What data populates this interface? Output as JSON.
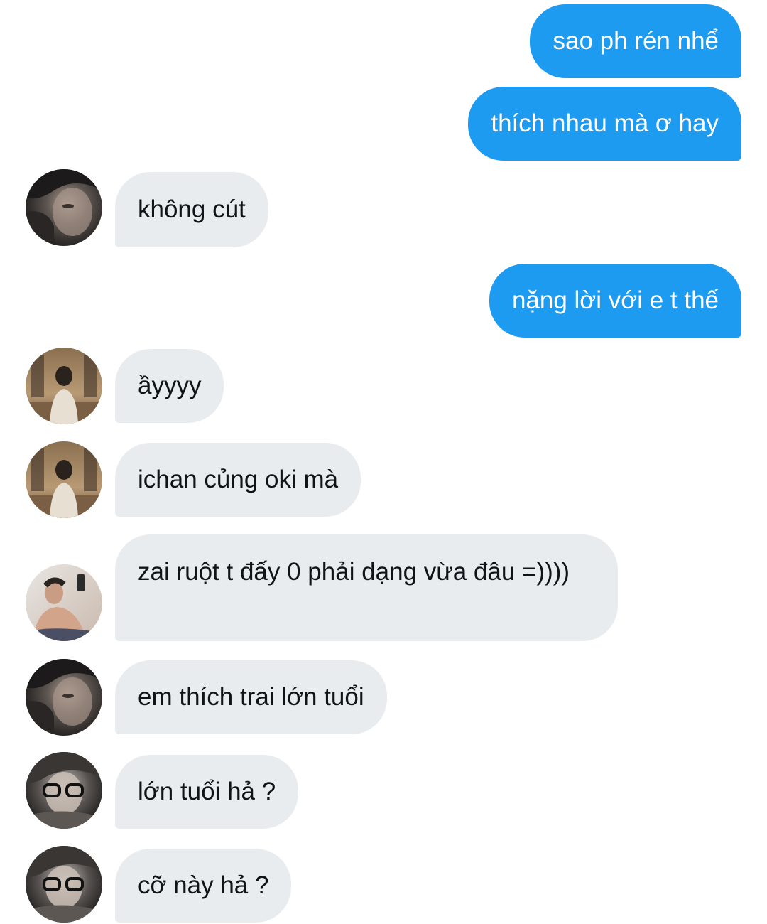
{
  "conversation": {
    "messages": [
      {
        "direction": "outgoing",
        "text": "sao ph rén nhể"
      },
      {
        "direction": "outgoing",
        "text": "thích nhau mà ơ hay"
      },
      {
        "direction": "incoming",
        "avatar": "girl-avatar",
        "text": "không cút"
      },
      {
        "direction": "outgoing",
        "text": "nặng lời với e t thế"
      },
      {
        "direction": "incoming",
        "avatar": "hallway-guy-avatar",
        "text": "ầyyyy"
      },
      {
        "direction": "incoming",
        "avatar": "hallway-guy-avatar",
        "text": "ichan củng oki mà"
      },
      {
        "direction": "incoming",
        "avatar": "mirror-selfie-avatar",
        "text": "zai ruột t đấy 0 phải dạng vừa đâu =))))"
      },
      {
        "direction": "incoming",
        "avatar": "girl-avatar",
        "text": "em thích trai lớn tuổi"
      },
      {
        "direction": "incoming",
        "avatar": "glasses-guy-avatar",
        "text": "lớn tuổi hả ?"
      },
      {
        "direction": "incoming",
        "avatar": "glasses-guy-avatar",
        "text": "cỡ này hả ?"
      }
    ]
  },
  "colors": {
    "outgoing_bubble": "#1d9bf0",
    "incoming_bubble": "#e8ecef",
    "incoming_text": "#0f1419",
    "outgoing_text": "#ffffff"
  }
}
